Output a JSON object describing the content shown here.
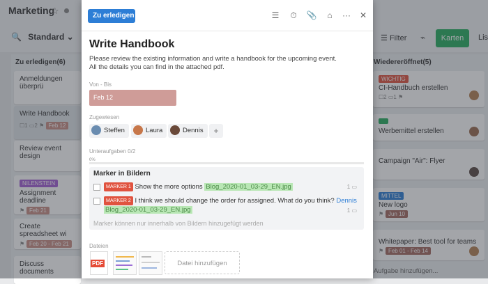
{
  "app": {
    "title": "Marketing",
    "view": "Standard",
    "filter_label": "Filter",
    "cards_label": "Karten",
    "list_label": "Lis"
  },
  "left_column": {
    "title": "Zu erledigen(6)",
    "cards": [
      {
        "title": "Anmeldungen überprü"
      },
      {
        "title": "Write Handbook",
        "subtasks": "1",
        "comments": "2",
        "date": "Feb 12"
      },
      {
        "title": "Review event design"
      },
      {
        "tag": "NILENSTEIN",
        "tag_color": "#a55fd6",
        "title": "Assignment deadline",
        "date": "Feb 21"
      },
      {
        "title": "Create spreadsheet wi",
        "date": "Feb 20 - Feb 21"
      },
      {
        "title": "Discuss documents"
      }
    ]
  },
  "right_column": {
    "title": "Wiedereröffnet(5)",
    "cards": [
      {
        "tag": "WICHTIG",
        "tag_color": "#e0533f",
        "title": "CI-Handbuch erstellen",
        "subtasks": "2",
        "comments": "1"
      },
      {
        "tag": "",
        "tag_color": "#27ae60",
        "title": "Werbemittel erstellen"
      },
      {
        "title": "Campaign \"Air\": Flyer"
      },
      {
        "tag": "MITTEL",
        "tag_color": "#2d7ed6",
        "title": "New logo",
        "date": "Jun 10"
      },
      {
        "title": "Whitepaper: Best tool for teams",
        "date": "Feb 01 - Feb 14"
      }
    ],
    "add_task": "Aufgabe hinzufügen..."
  },
  "modal": {
    "status": "Zu erledigen",
    "title": "Write Handbook",
    "description_1": "Please review the existing information and write a handbook for the upcoming event.",
    "description_2": "All the details you can find in the attached pdf.",
    "date_label": "Von - Bis",
    "date_value": "Feb 12",
    "assigned_label": "Zugewiesen",
    "assignees": [
      "Steffen",
      "Laura",
      "Dennis"
    ],
    "subtasks_label": "Unteraufgaben",
    "subtasks_count": "0/2",
    "subtasks_pct": "0%",
    "markers": {
      "title": "Marker in Bildern",
      "items": [
        {
          "badge": "MARKER",
          "num": "1",
          "text": "Show the more options",
          "file": "Blog_2020-01_03-29_EN.jpg",
          "count": "1"
        },
        {
          "badge": "MARKER",
          "num": "2",
          "text": "I think we should change the order for assigned. What do you think?",
          "user": "Dennis",
          "file": "Blog_2020-01_03-29_EN.jpg",
          "count": "1"
        }
      ],
      "hint": "Marker können nur innerhalb von Bildern hinzugefügt werden"
    },
    "files_label": "Dateien",
    "pdf_label": "PDF",
    "upload_label": "Datei hinzufügen"
  }
}
